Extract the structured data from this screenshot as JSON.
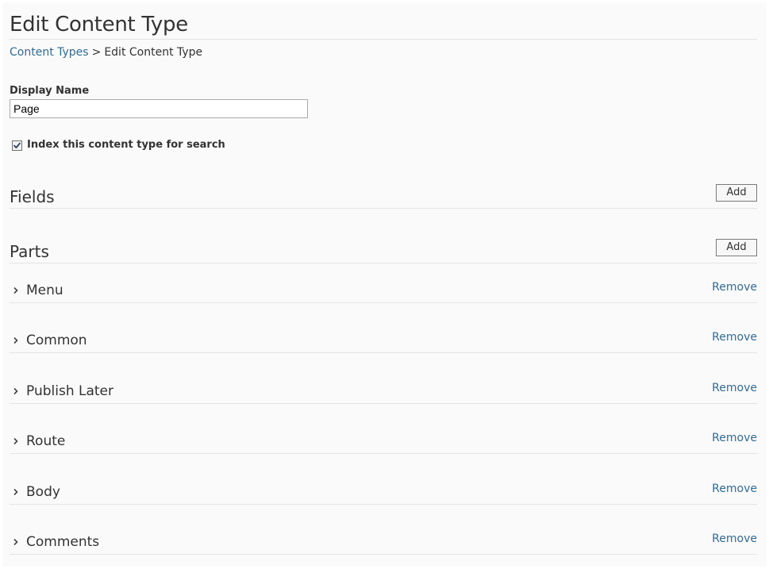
{
  "header": {
    "title": "Edit Content Type"
  },
  "breadcrumb": {
    "link_label": "Content Types",
    "separator": ">",
    "current": "Edit Content Type"
  },
  "form": {
    "display_name_label": "Display Name",
    "display_name_value": "Page",
    "index_checkbox_label": "Index this content type for search",
    "index_checked": true
  },
  "fields": {
    "heading": "Fields",
    "add_label": "Add"
  },
  "parts": {
    "heading": "Parts",
    "add_label": "Add",
    "items": [
      {
        "name": "Menu",
        "remove_label": "Remove",
        "icon": "chevron-right-icon"
      },
      {
        "name": "Common",
        "remove_label": "Remove",
        "icon": "chevron-right-icon"
      },
      {
        "name": "Publish Later",
        "remove_label": "Remove",
        "icon": "chevron-right-icon"
      },
      {
        "name": "Route",
        "remove_label": "Remove",
        "icon": "chevron-right-icon"
      },
      {
        "name": "Body",
        "remove_label": "Remove",
        "icon": "chevron-right-icon"
      },
      {
        "name": "Comments",
        "remove_label": "Remove",
        "icon": "chevron-right-icon"
      }
    ]
  },
  "colors": {
    "link": "#336b92",
    "text": "#333333",
    "divider": "#e4e4e4",
    "background": "#fafafa"
  }
}
